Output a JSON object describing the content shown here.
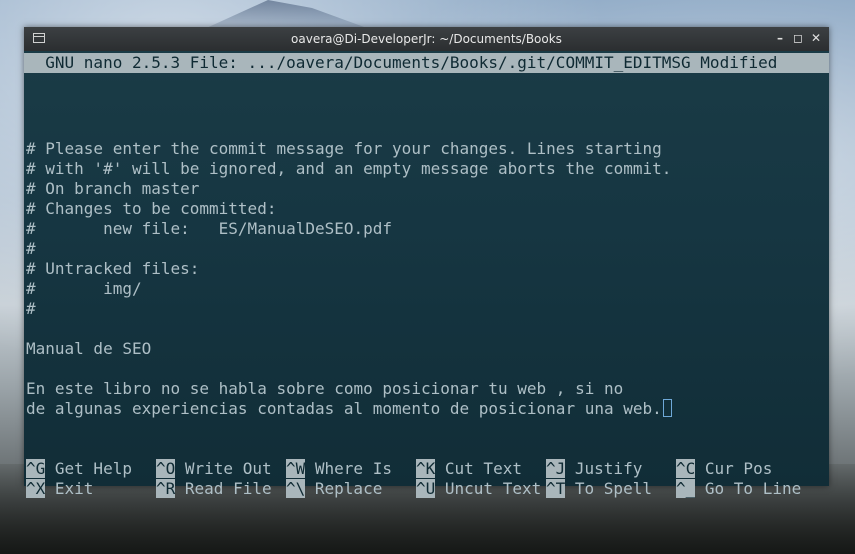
{
  "window": {
    "title": "oavera@Di-DeveloperJr: ~/Documents/Books",
    "minimize_glyph": "–",
    "maximize_glyph": "◻",
    "close_glyph": "✕"
  },
  "nano": {
    "header": "  GNU nano 2.5.3 File: .../oavera/Documents/Books/.git/COMMIT_EDITMSG Modified  ",
    "lines": [
      "",
      "",
      "# Please enter the commit message for your changes. Lines starting",
      "# with '#' will be ignored, and an empty message aborts the commit.",
      "# On branch master",
      "# Changes to be committed:",
      "#       new file:   ES/ManualDeSEO.pdf",
      "#",
      "# Untracked files:",
      "#       img/",
      "#",
      "",
      "Manual de SEO",
      "",
      "En este libro no se habla sobre como posicionar tu web , si no",
      "de algunas experiencias contadas al momento de posicionar una web."
    ],
    "shortcuts_row1": [
      {
        "key": "^G",
        "label": " Get Help"
      },
      {
        "key": "^O",
        "label": " Write Out"
      },
      {
        "key": "^W",
        "label": " Where Is"
      },
      {
        "key": "^K",
        "label": " Cut Text"
      },
      {
        "key": "^J",
        "label": " Justify"
      },
      {
        "key": "^C",
        "label": " Cur Pos"
      }
    ],
    "shortcuts_row2": [
      {
        "key": "^X",
        "label": " Exit"
      },
      {
        "key": "^R",
        "label": " Read File"
      },
      {
        "key": "^\\",
        "label": " Replace"
      },
      {
        "key": "^U",
        "label": " Uncut Text"
      },
      {
        "key": "^T",
        "label": " To Spell"
      },
      {
        "key": "^_",
        "label": " Go To Line"
      }
    ]
  }
}
